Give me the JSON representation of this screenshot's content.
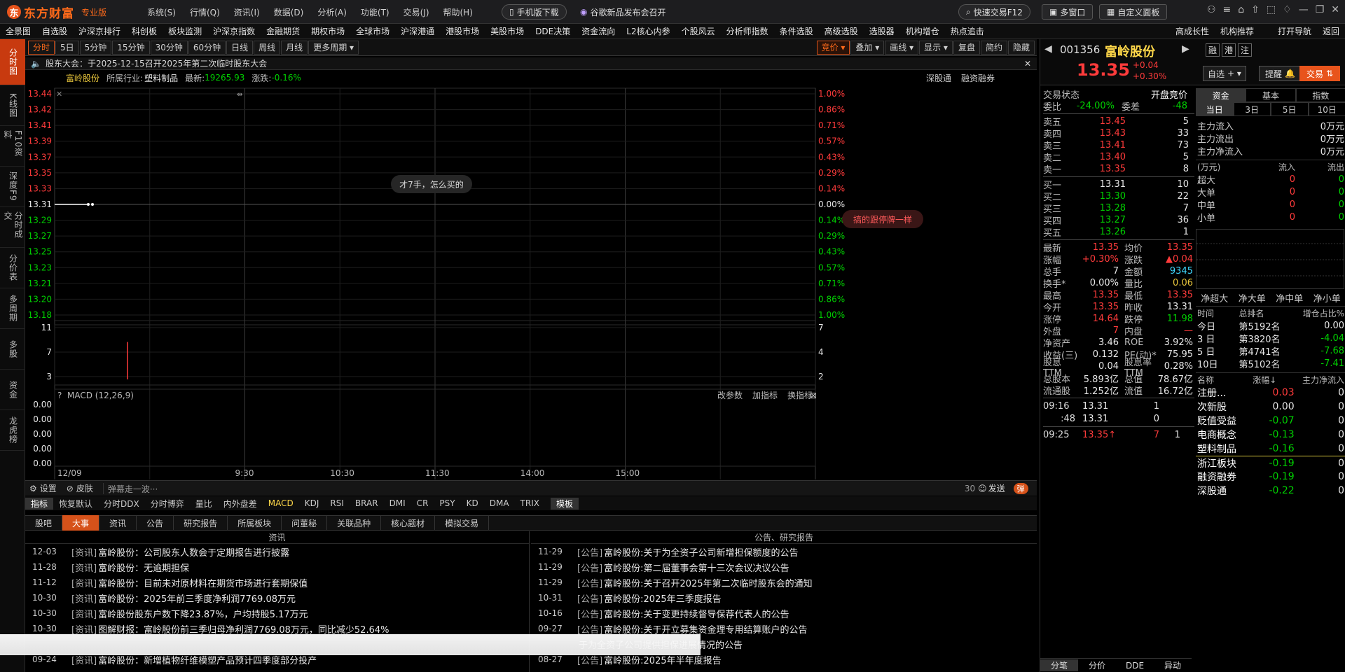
{
  "app": {
    "brand": "东方财富",
    "edition": "专业版"
  },
  "main_menu": [
    "系统(S)",
    "行情(Q)",
    "资讯(I)",
    "数据(D)",
    "分析(A)",
    "功能(T)",
    "交易(J)",
    "帮助(H)"
  ],
  "promo": {
    "mobile": "手机版下载",
    "news": "谷歌新品发布会召开"
  },
  "right_buttons": {
    "quick_trade": "快速交易F12",
    "multi_window": "多窗口",
    "custom_panel": "自定义面板"
  },
  "nav2": [
    "全景图",
    "自选股",
    "沪深京排行",
    "科创板",
    "板块监测",
    "沪深京指数",
    "金融期货",
    "期权市场",
    "全球市场",
    "沪深港通",
    "港股市场",
    "美股市场",
    "DDE决策",
    "资金流向",
    "L2核心内参",
    "个股风云",
    "分析师指数",
    "条件选股",
    "高级选股",
    "选股器",
    "机构增仓",
    "热点追击",
    "高成长性",
    "机构推荐",
    "打开导航",
    "返回"
  ],
  "side_tabs": [
    "分时图",
    "K线图",
    "F10资料",
    "深度F9",
    "分时成交",
    "分价表",
    "多周期",
    "多股",
    "资金",
    "龙虎榜"
  ],
  "periods": [
    "分时",
    "5日",
    "5分钟",
    "15分钟",
    "30分钟",
    "60分钟",
    "日线",
    "周线",
    "月线",
    "更多周期"
  ],
  "chart_tools_right": [
    "竞价",
    "叠加",
    "画线",
    "显示",
    "复盘",
    "简约",
    "隐藏"
  ],
  "notice": "股东大会：于2025-12-15召开2025年第二次临时股东大会",
  "infobar": {
    "name": "富岭股份",
    "industry_label": "所属行业:",
    "industry": "塑料制品",
    "latest_label": "最新:",
    "latest": "19265.93",
    "change_label": "涨跌:",
    "change": "-0.16%",
    "right1": "深股通",
    "right2": "融资融券"
  },
  "chart_data": {
    "type": "line",
    "title": "",
    "price_ticks": [
      "13.44",
      "13.42",
      "13.41",
      "13.39",
      "13.37",
      "13.35",
      "13.33",
      "13.31",
      "13.29",
      "13.27",
      "13.25",
      "13.23",
      "13.21",
      "13.20",
      "13.18"
    ],
    "pct_ticks": [
      "1.00%",
      "0.86%",
      "0.71%",
      "0.57%",
      "0.43%",
      "0.29%",
      "0.14%",
      "0.00%",
      "0.14%",
      "0.29%",
      "0.43%",
      "0.57%",
      "0.71%",
      "0.86%",
      "1.00%"
    ],
    "base_price": 13.31,
    "price_series": [
      13.31,
      13.31,
      13.31,
      13.31,
      13.31
    ],
    "volume_ticks_left": [
      "11",
      "7",
      "3"
    ],
    "volume_ticks_right": [
      "7",
      "4",
      "2"
    ],
    "volume_bar": 7,
    "volume_max": 11,
    "macd_label": "MACD (12,26,9)",
    "macd_ticks": [
      "0.00",
      "0.00",
      "0.00",
      "0.00",
      "0.00"
    ],
    "macd_tools": [
      "改参数",
      "加指标",
      "换指标"
    ],
    "time_labels": [
      "12/09",
      "9:30",
      "10:30",
      "11:30",
      "14:00",
      "15:00"
    ],
    "bubble1": "才7手，怎么买的",
    "bubble2": "搞的跟停牌一样"
  },
  "chart_foot": {
    "settings": "设置",
    "skin": "皮肤",
    "danmu_placeholder": "弹幕走一波···",
    "count": "30",
    "send": "发送",
    "toggle": "弹"
  },
  "indicator_tabs": [
    "指标",
    "恢复默认",
    "分时DDX",
    "分时博弈",
    "量比",
    "内外盘差",
    "MACD",
    "KDJ",
    "RSI",
    "BRAR",
    "DMI",
    "CR",
    "PSY",
    "KD",
    "DMA",
    "TRIX",
    "模板"
  ],
  "news_tabs": [
    "股吧",
    "大事",
    "资讯",
    "公告",
    "研究报告",
    "所属板块",
    "问董秘",
    "关联品种",
    "核心题材",
    "模拟交易"
  ],
  "news_left_title": "资讯",
  "news_left": [
    {
      "d": "12-03",
      "t": "[资讯]",
      "s": "富岭股份：公司股东人数会于定期报告进行披露"
    },
    {
      "d": "11-28",
      "t": "[资讯]",
      "s": "富岭股份：无逾期担保"
    },
    {
      "d": "11-12",
      "t": "[资讯]",
      "s": "富岭股份：目前未对原材料在期货市场进行套期保值"
    },
    {
      "d": "10-30",
      "t": "[资讯]",
      "s": "富岭股份：2025年前三季度净利润7769.08万元"
    },
    {
      "d": "10-30",
      "t": "[资讯]",
      "s": "富岭股份股东户数下降23.87%，户均持股5.17万元"
    },
    {
      "d": "10-30",
      "t": "[资讯]",
      "s": "图解财报：富岭股份前三季归母净利润7769.08万元，同比减少52.64%"
    },
    {
      "d": "",
      "t": "",
      "s": ""
    },
    {
      "d": "09-24",
      "t": "[资讯]",
      "s": "富岭股份：新增植物纤维模塑产品预计四季度部分投产"
    }
  ],
  "news_right_title": "公告、研究报告",
  "news_right": [
    {
      "d": "11-29",
      "t": "[公告]",
      "s": "富岭股份:关于为全资子公司新增担保额度的公告"
    },
    {
      "d": "11-29",
      "t": "[公告]",
      "s": "富岭股份:第二届董事会第十三次会议决议公告"
    },
    {
      "d": "11-29",
      "t": "[公告]",
      "s": "富岭股份:关于召开2025年第二次临时股东会的通知"
    },
    {
      "d": "10-31",
      "t": "[公告]",
      "s": "富岭股份:2025年三季度报告"
    },
    {
      "d": "10-16",
      "t": "[公告]",
      "s": "富岭股份:关于变更持续督导保荐代表人的公告"
    },
    {
      "d": "09-27",
      "t": "[公告]",
      "s": "富岭股份:关于开立募集资金理专用结算账户的公告"
    },
    {
      "d": "",
      "t": "",
      "s": "于为全资子公司提供担保进展情况的公告"
    },
    {
      "d": "08-27",
      "t": "[公告]",
      "s": "富岭股份:2025年半年度报告"
    }
  ],
  "stock": {
    "code": "001356",
    "name": "富岭股份",
    "price": "13.35",
    "chg": "+0.04",
    "pct": "+0.30%",
    "tags": [
      "融",
      "港",
      "注"
    ],
    "watch": "自选",
    "remind": "提醒",
    "trade": "交易"
  },
  "trade_status": {
    "label": "交易状态",
    "value": "开盘竞价",
    "wb_label": "委比",
    "wb": "-24.00%",
    "wc_label": "委差",
    "wc": "-48"
  },
  "sells": [
    {
      "l": "卖五",
      "p": "13.45",
      "v": "5"
    },
    {
      "l": "卖四",
      "p": "13.43",
      "v": "33"
    },
    {
      "l": "卖三",
      "p": "13.41",
      "v": "73"
    },
    {
      "l": "卖二",
      "p": "13.40",
      "v": "5"
    },
    {
      "l": "卖一",
      "p": "13.35",
      "v": "8"
    }
  ],
  "buys": [
    {
      "l": "买一",
      "p": "13.31",
      "v": "10"
    },
    {
      "l": "买二",
      "p": "13.30",
      "v": "22"
    },
    {
      "l": "买三",
      "p": "13.28",
      "v": "7"
    },
    {
      "l": "买四",
      "p": "13.27",
      "v": "36"
    },
    {
      "l": "买五",
      "p": "13.26",
      "v": "1"
    }
  ],
  "stats": [
    [
      "最新",
      "13.35",
      "均价",
      "13.35"
    ],
    [
      "涨幅",
      "+0.30%",
      "涨跌",
      "▲0.04"
    ],
    [
      "总手",
      "7",
      "金额",
      "9345"
    ],
    [
      "换手*",
      "0.00%",
      "量比",
      "0.06"
    ],
    [
      "最高",
      "13.35",
      "最低",
      "13.35"
    ],
    [
      "今开",
      "13.35",
      "昨收",
      "13.31"
    ],
    [
      "涨停",
      "14.64",
      "跌停",
      "11.98"
    ],
    [
      "外盘",
      "7",
      "内盘",
      "—"
    ],
    [
      "净资产",
      "3.46",
      "ROE",
      "3.92%"
    ],
    [
      "收益(三)",
      "0.132",
      "PE(动)*",
      "75.95"
    ],
    [
      "股息TTM",
      "0.04",
      "股息率TTM",
      "0.28%"
    ],
    [
      "总股本",
      "5.893亿",
      "总值",
      "78.67亿"
    ],
    [
      "流通股",
      "1.252亿",
      "流值",
      "16.72亿"
    ]
  ],
  "ticks": [
    [
      "09:16",
      "13.31",
      "1",
      ""
    ],
    [
      ":48",
      "13.31",
      "0",
      ""
    ],
    [
      "09:25",
      "13.35",
      "7",
      "1"
    ]
  ],
  "bottom_tabs": [
    "分笔",
    "分价",
    "DDE",
    "异动"
  ],
  "fund_tabs": [
    "资金",
    "基本",
    "指数"
  ],
  "fund_periods": [
    "当日",
    "3日",
    "5日",
    "10日"
  ],
  "fund_main": [
    [
      "主力流入",
      "0万元"
    ],
    [
      "主力流出",
      "0万元"
    ],
    [
      "主力净流入",
      "0万元"
    ]
  ],
  "fund_table_head": [
    "(万元)",
    "流入",
    "流出"
  ],
  "fund_rows": [
    [
      "超大",
      "0",
      "0"
    ],
    [
      "大单",
      "0",
      "0"
    ],
    [
      "中单",
      "0",
      "0"
    ],
    [
      "小单",
      "0",
      "0"
    ]
  ],
  "net_labels": [
    "净超大",
    "净大单",
    "净中单",
    "净小单"
  ],
  "rank_head": [
    "时间",
    "总排名",
    "增仓占比%"
  ],
  "ranks": [
    [
      "今日",
      "第5192名",
      "0.00"
    ],
    [
      "3 日",
      "第3820名",
      "-4.04"
    ],
    [
      "5 日",
      "第4741名",
      "-7.68"
    ],
    [
      "10日",
      "第5102名",
      "-7.41"
    ]
  ],
  "sector_head": [
    "名称",
    "涨幅↓",
    "主力净流入"
  ],
  "sectors": [
    [
      "注册...",
      "0.03",
      "0"
    ],
    [
      "次新股",
      "0.00",
      "0"
    ],
    [
      "贬值受益",
      "-0.07",
      "0"
    ],
    [
      "电商概念",
      "-0.13",
      "0"
    ],
    [
      "塑料制品",
      "-0.16",
      "0"
    ],
    [
      "浙江板块",
      "-0.19",
      "0"
    ],
    [
      "融资融券",
      "-0.19",
      "0"
    ],
    [
      "深股通",
      "-0.22",
      "0"
    ]
  ]
}
